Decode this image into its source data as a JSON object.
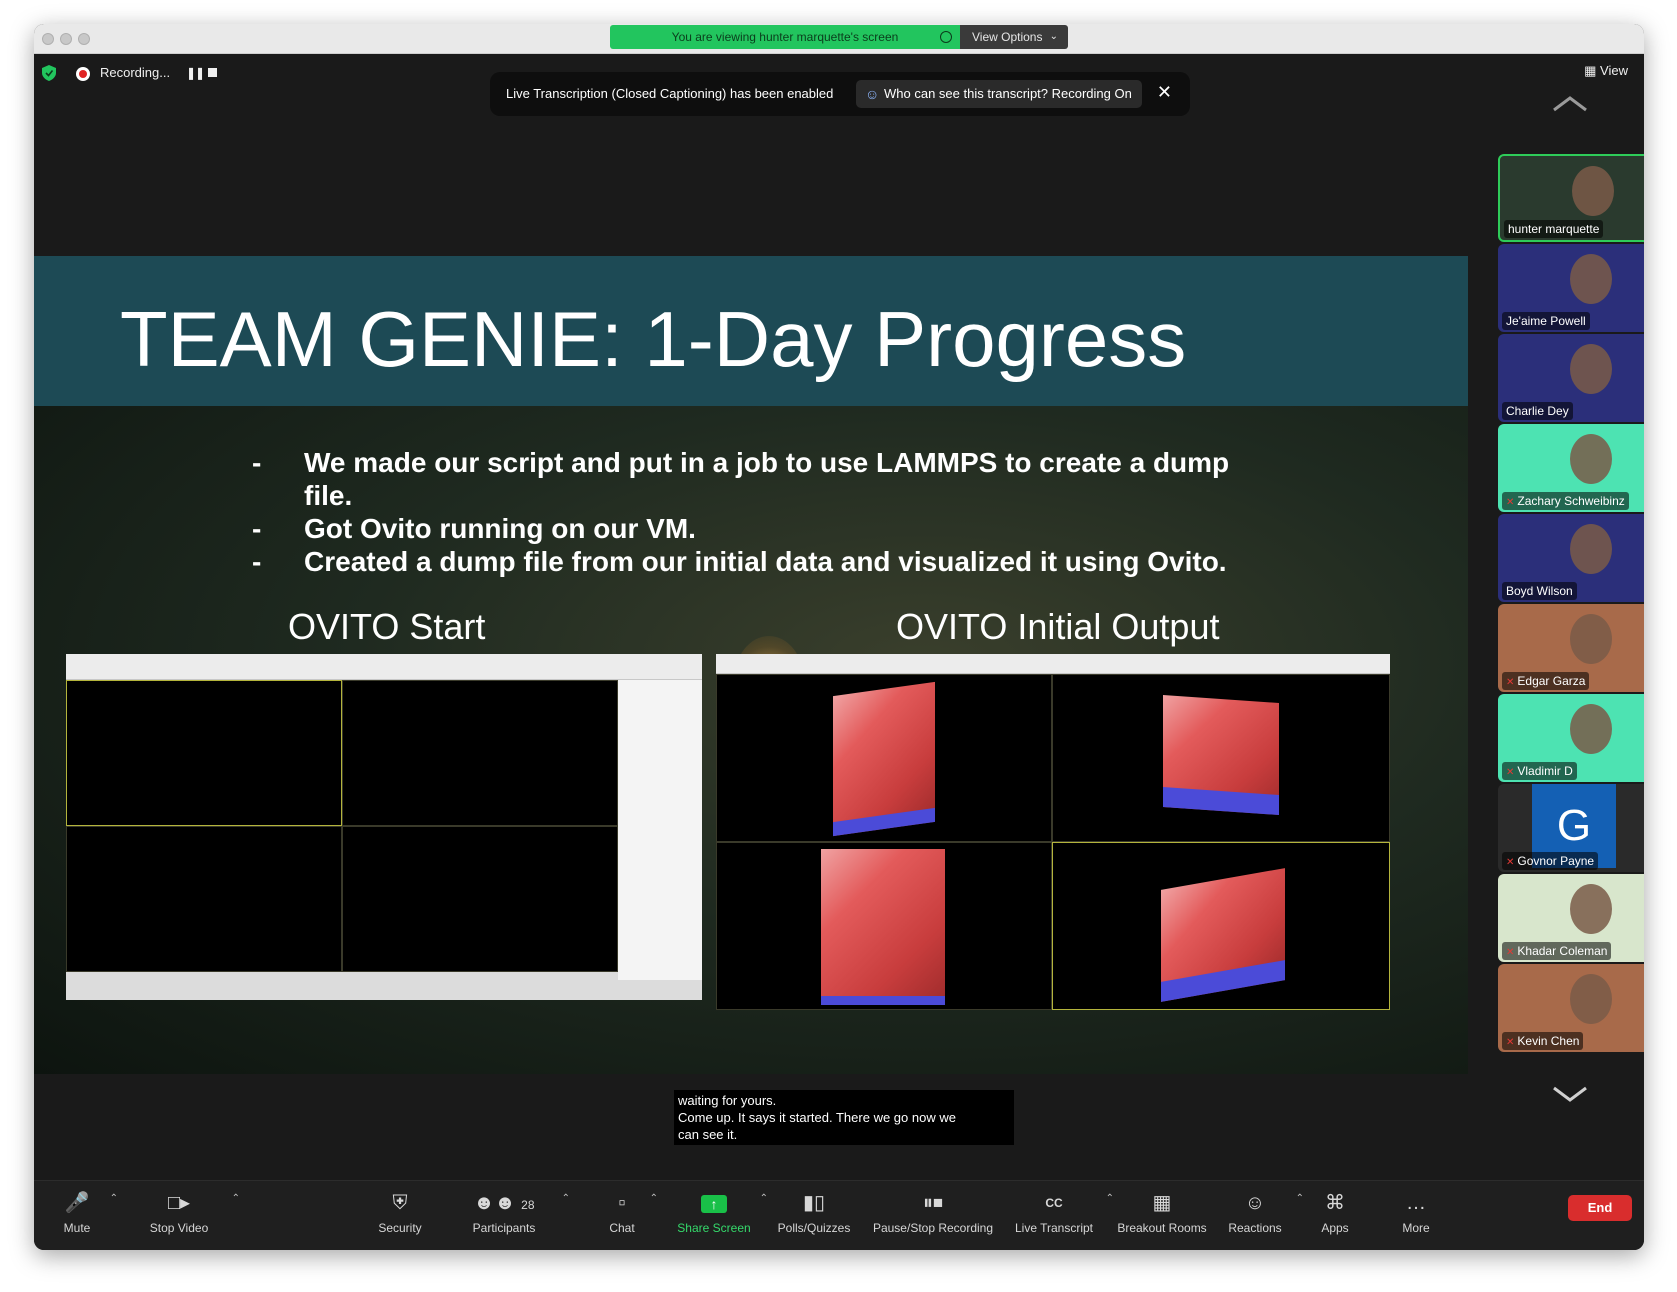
{
  "window": {
    "traffic_lights": [
      "close",
      "minimize",
      "zoom"
    ]
  },
  "banner": {
    "viewing_text": "You are viewing hunter marquette's screen",
    "view_options_label": "View Options"
  },
  "recording": {
    "label": "Recording..."
  },
  "view_button": {
    "label": "View"
  },
  "caption_notice": {
    "message": "Live Transcription (Closed Captioning) has been enabled",
    "who_label": "Who can see this transcript? Recording On"
  },
  "slide": {
    "title": "TEAM GENIE: 1-Day Progress",
    "bullets": [
      "We made our script and put in a job to use LAMMPS to create a dump file.",
      "Got Ovito running on our VM.",
      "Created a dump file from our initial data and visualized it using Ovito."
    ],
    "left_label": "OVITO Start",
    "right_label": "OVITO Initial Output"
  },
  "participants": [
    {
      "name": "hunter marquette",
      "muted": false,
      "active": true,
      "bg": "#2a3a2e"
    },
    {
      "name": "Je'aime Powell",
      "muted": false,
      "active": false,
      "bg": "#2b2f7a"
    },
    {
      "name": "Charlie Dey",
      "muted": false,
      "active": false,
      "bg": "#2b2f7a"
    },
    {
      "name": "Zachary Schweibinz",
      "muted": true,
      "active": false,
      "bg": "#4de3b2"
    },
    {
      "name": "Boyd Wilson",
      "muted": false,
      "active": false,
      "bg": "#2b2f7a"
    },
    {
      "name": "Edgar Garza",
      "muted": true,
      "active": false,
      "bg": "#a86a4a"
    },
    {
      "name": "Vladimir D",
      "muted": true,
      "active": false,
      "bg": "#4de3b2"
    },
    {
      "name": "Govnor Payne",
      "muted": true,
      "active": false,
      "bg": "#2a2a2a",
      "initial": "G"
    },
    {
      "name": "Khadar Coleman",
      "muted": true,
      "active": false,
      "bg": "#d8e6cc"
    },
    {
      "name": "Kevin Chen",
      "muted": true,
      "active": false,
      "bg": "#a86a4a"
    }
  ],
  "subtitles": {
    "lines": [
      "waiting for yours.",
      "Come up. It says it started. There we go now we",
      "can see it."
    ]
  },
  "toolbar": {
    "mute": "Mute",
    "stop_video": "Stop Video",
    "security": "Security",
    "participants": "Participants",
    "participants_count": "28",
    "chat": "Chat",
    "share_screen": "Share Screen",
    "polls": "Polls/Quizzes",
    "pause_recording": "Pause/Stop Recording",
    "live_transcript": "Live Transcript",
    "breakout_rooms": "Breakout Rooms",
    "reactions": "Reactions",
    "apps": "Apps",
    "more": "More",
    "end": "End"
  },
  "colors": {
    "accent_green": "#22c55e",
    "end_red": "#d92d2d",
    "slide_header": "#1d4a55",
    "cube_red": "#e35b5b",
    "cube_blue": "#4b4bd8"
  }
}
